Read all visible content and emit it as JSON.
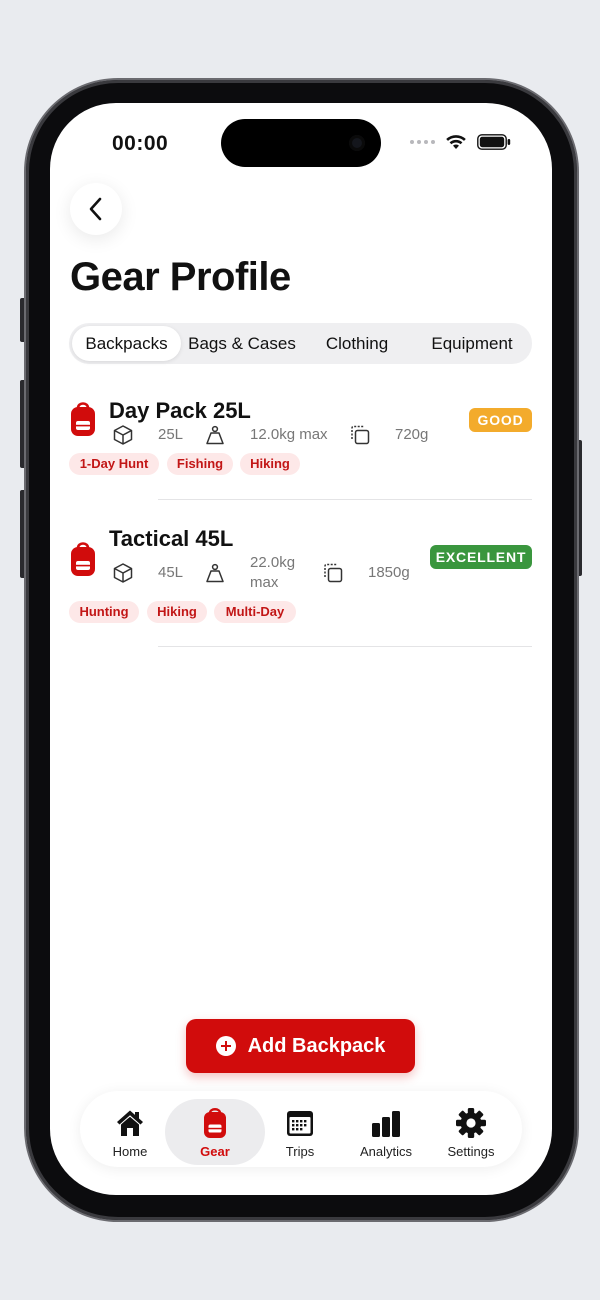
{
  "status_bar": {
    "time": "00:00"
  },
  "header": {
    "back_icon": "chevron-left-icon",
    "title": "Gear Profile"
  },
  "tabs": [
    {
      "label": "Backpacks",
      "active": true
    },
    {
      "label": "Bags & Cases",
      "active": false
    },
    {
      "label": "Clothing",
      "active": false
    },
    {
      "label": "Equipment",
      "active": false
    }
  ],
  "items": [
    {
      "name": "Day Pack 25L",
      "icon": "backpack-icon",
      "capacity": "25L",
      "max_load": "12.0kg max",
      "weight": "720g",
      "condition": "GOOD",
      "condition_color": "#f3ab2c",
      "tags": [
        "1-Day Hunt",
        "Fishing",
        "Hiking"
      ]
    },
    {
      "name": "Tactical 45L",
      "icon": "backpack-icon",
      "capacity": "45L",
      "max_load_line1": "22.0kg",
      "max_load_line2": "max",
      "weight": "1850g",
      "condition": "EXCELLENT",
      "condition_color": "#3a963e",
      "tags": [
        "Hunting",
        "Hiking",
        "Multi-Day"
      ]
    }
  ],
  "add_button": {
    "label": "Add Backpack",
    "icon": "plus-circle-icon"
  },
  "nav": [
    {
      "label": "Home",
      "icon": "home-icon",
      "active": false
    },
    {
      "label": "Gear",
      "icon": "backpack-icon",
      "active": true
    },
    {
      "label": "Trips",
      "icon": "calendar-icon",
      "active": false
    },
    {
      "label": "Analytics",
      "icon": "bar-chart-icon",
      "active": false
    },
    {
      "label": "Settings",
      "icon": "gear-icon",
      "active": false
    }
  ],
  "colors": {
    "accent": "#d10c0c",
    "good": "#f3ab2c",
    "excellent": "#3a963e",
    "tag_bg": "#fde8e8"
  }
}
